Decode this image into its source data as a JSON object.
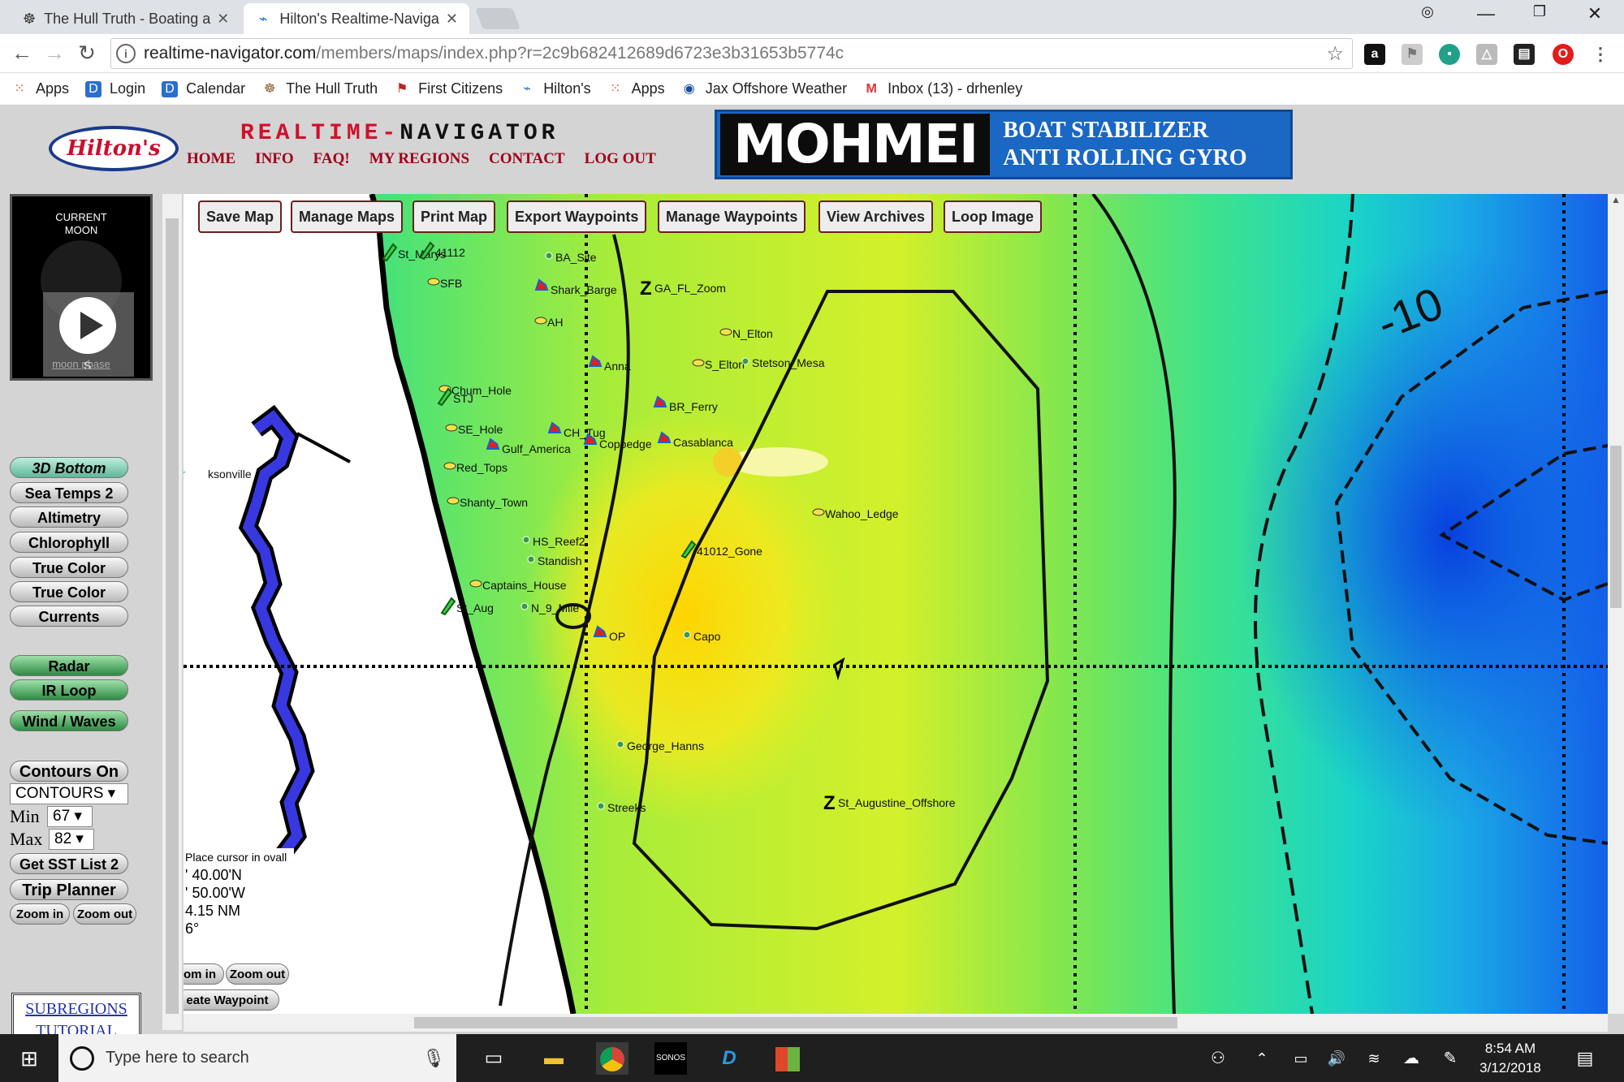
{
  "browser": {
    "tabs": [
      {
        "title": "The Hull Truth - Boating a",
        "active": false
      },
      {
        "title": "Hilton's Realtime-Naviga",
        "active": true
      }
    ],
    "url_host": "realtime-navigator.com",
    "url_path": "/members/maps/index.php?r=2c9b682412689d6723e3b31653b5774c",
    "bookmarks": [
      "Apps",
      "Login",
      "Calendar",
      "The Hull Truth",
      "First Citizens",
      "Hilton's",
      "Apps",
      "Jax Offshore Weather",
      "Inbox (13) - drhenley"
    ]
  },
  "site": {
    "logo_text": "Hilton's",
    "title_red": "REALTIME-",
    "title_black": "NAVIGATOR",
    "nav": [
      "HOME",
      "INFO",
      "FAQ!",
      "MY REGIONS",
      "CONTACT",
      "LOG OUT"
    ],
    "ad_brand": "MOHMEI",
    "ad_line1": "BOAT STABILIZER",
    "ad_line2": "ANTI ROLLING GYRO"
  },
  "left_panel": {
    "moon_label_1": "CURRENT",
    "moon_label_2": "MOON",
    "moon_s": "S",
    "moon_link": "moon phase",
    "layers": [
      "3D Bottom",
      "Sea Temps 2",
      "Altimetry",
      "Chlorophyll",
      "True Color",
      "True Color",
      "Currents"
    ],
    "weather": [
      "Radar",
      "IR Loop",
      "Wind / Waves"
    ],
    "contours_btn": "Contours On",
    "contours_select": "CONTOURS",
    "min_label": "Min",
    "min_value": "67",
    "max_label": "Max",
    "max_value": "82",
    "sst_btn": "Get SST List 2",
    "trip_btn": "Trip Planner",
    "zoom_in": "Zoom in",
    "zoom_out": "Zoom out",
    "subregions": "SUBREGIONS",
    "tutorial": "TUTORIAL"
  },
  "map": {
    "toolbar": [
      "Save Map",
      "Manage Maps",
      "Print Map",
      "Export Waypoints",
      "Manage Waypoints",
      "View Archives",
      "Loop Image"
    ],
    "contour_label": "-10",
    "city": "ksonville",
    "readout": [
      "Place cursor in ovall",
      "' 40.00'N",
      "' 50.00'W",
      "4.15 NM",
      "6°"
    ],
    "zoom_in": "om in",
    "zoom_out": "Zoom out",
    "create_waypoint": "eate Waypoint",
    "waypoints": [
      {
        "name": "St_Marys",
        "icon": "green"
      },
      {
        "name": "41112",
        "icon": "green"
      },
      {
        "name": "BA_Site",
        "icon": "dot"
      },
      {
        "name": "SFB",
        "icon": "fish"
      },
      {
        "name": "Shark_Barge",
        "icon": "wreck"
      },
      {
        "name": "GA_FL_Zoom",
        "icon": "z"
      },
      {
        "name": "AH",
        "icon": "fish"
      },
      {
        "name": "N_Elton",
        "icon": "fish"
      },
      {
        "name": "Anna",
        "icon": "wreck"
      },
      {
        "name": "S_Elton",
        "icon": "fish"
      },
      {
        "name": "Stetson_Mesa",
        "icon": "dot"
      },
      {
        "name": "Chum_Hole",
        "icon": "fish"
      },
      {
        "name": "STJ",
        "icon": "green"
      },
      {
        "name": "BR_Ferry",
        "icon": "wreck"
      },
      {
        "name": "SE_Hole",
        "icon": "fish"
      },
      {
        "name": "CH_Tug",
        "icon": "wreck"
      },
      {
        "name": "Coppedge",
        "icon": "wreck"
      },
      {
        "name": "Casablanca",
        "icon": "wreck"
      },
      {
        "name": "Gulf_America",
        "icon": "wreck"
      },
      {
        "name": "Red_Tops",
        "icon": "fish"
      },
      {
        "name": "Shanty_Town",
        "icon": "fish"
      },
      {
        "name": "Wahoo_Ledge",
        "icon": "fish"
      },
      {
        "name": "HS_Reef2",
        "icon": "dot"
      },
      {
        "name": "41012_Gone",
        "icon": "green"
      },
      {
        "name": "Standish",
        "icon": "dot"
      },
      {
        "name": "Captains_House",
        "icon": "fish"
      },
      {
        "name": "St_Aug",
        "icon": "green"
      },
      {
        "name": "N_9_Mile",
        "icon": "dot"
      },
      {
        "name": "OP",
        "icon": "wreck"
      },
      {
        "name": "Capo",
        "icon": "dot"
      },
      {
        "name": "George_Hanns",
        "icon": "dot"
      },
      {
        "name": "Streeks",
        "icon": "dot"
      },
      {
        "name": "St_Augustine_Offshore",
        "icon": "z"
      }
    ]
  },
  "taskbar": {
    "search_placeholder": "Type here to search",
    "time": "8:54 AM",
    "date": "3/12/2018"
  }
}
